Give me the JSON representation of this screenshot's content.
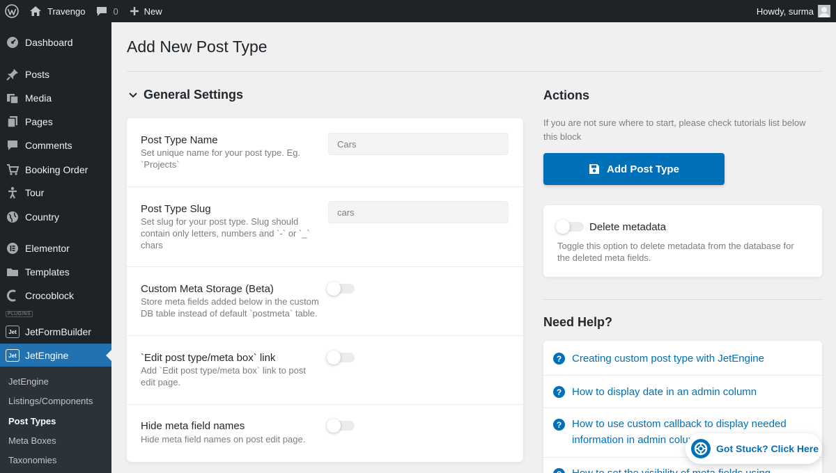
{
  "adminbar": {
    "site_name": "Travengo",
    "comments_count": "0",
    "new_label": "New",
    "howdy": "Howdy, surma"
  },
  "sidebar": {
    "items": [
      {
        "label": "Dashboard",
        "icon": "dashboard-icon"
      },
      {
        "label": "Posts",
        "icon": "pin-icon"
      },
      {
        "label": "Media",
        "icon": "media-icon"
      },
      {
        "label": "Pages",
        "icon": "pages-icon"
      },
      {
        "label": "Comments",
        "icon": "comments-icon"
      },
      {
        "label": "Booking Order",
        "icon": "cart-icon"
      },
      {
        "label": "Tour",
        "icon": "person-icon"
      },
      {
        "label": "Country",
        "icon": "globe-icon"
      },
      {
        "label": "Elementor",
        "icon": "elementor-icon"
      },
      {
        "label": "Templates",
        "icon": "folder-icon"
      },
      {
        "label": "Crocoblock",
        "icon": "crocoblock-icon"
      },
      {
        "label": "JetFormBuilder",
        "icon": "jet-icon"
      },
      {
        "label": "JetEngine",
        "icon": "jet-icon"
      }
    ],
    "plugins_label": "PLUGINS",
    "jet_badge": "Jet",
    "submenu": [
      {
        "label": "JetEngine"
      },
      {
        "label": "Listings/Components"
      },
      {
        "label": "Post Types"
      },
      {
        "label": "Meta Boxes"
      },
      {
        "label": "Taxonomies"
      }
    ]
  },
  "main": {
    "page_title": "Add New Post Type",
    "section_title": "General Settings",
    "fields": [
      {
        "label": "Post Type Name",
        "desc": "Set unique name for your post type. Eg. `Projects`",
        "value": "Cars"
      },
      {
        "label": "Post Type Slug",
        "desc": "Set slug for your post type. Slug should contain only letters, numbers and `-` or `_` chars",
        "value": "cars"
      },
      {
        "label": "Custom Meta Storage (Beta)",
        "desc": "Store meta fields added below in the custom DB table instead of default `postmeta` table."
      },
      {
        "label": "`Edit post type/meta box` link",
        "desc": "Add `Edit post type/meta box` link to post edit page."
      },
      {
        "label": "Hide meta field names",
        "desc": "Hide meta field names on post edit page."
      }
    ]
  },
  "actions": {
    "title": "Actions",
    "desc": "If you are not sure where to start, please check tutorials list below this block",
    "add_button": "Add Post Type",
    "delete_label": "Delete metadata",
    "delete_desc": "Toggle this option to delete metadata from the database for the deleted meta fields."
  },
  "help": {
    "title": "Need Help?",
    "icon_glyph": "?",
    "links": [
      {
        "label": "Creating custom post type with JetEngine"
      },
      {
        "label": "How to display date in an admin column"
      },
      {
        "label": "How to use custom callback to display needed information in admin column"
      },
      {
        "label": "How to set the visibility of meta fields using"
      }
    ],
    "stuck_label": "Got Stuck? Click Here"
  },
  "colors": {
    "accent": "#0070b8",
    "sidebar_bg": "#1d2327",
    "active_menu": "#2271b1"
  }
}
